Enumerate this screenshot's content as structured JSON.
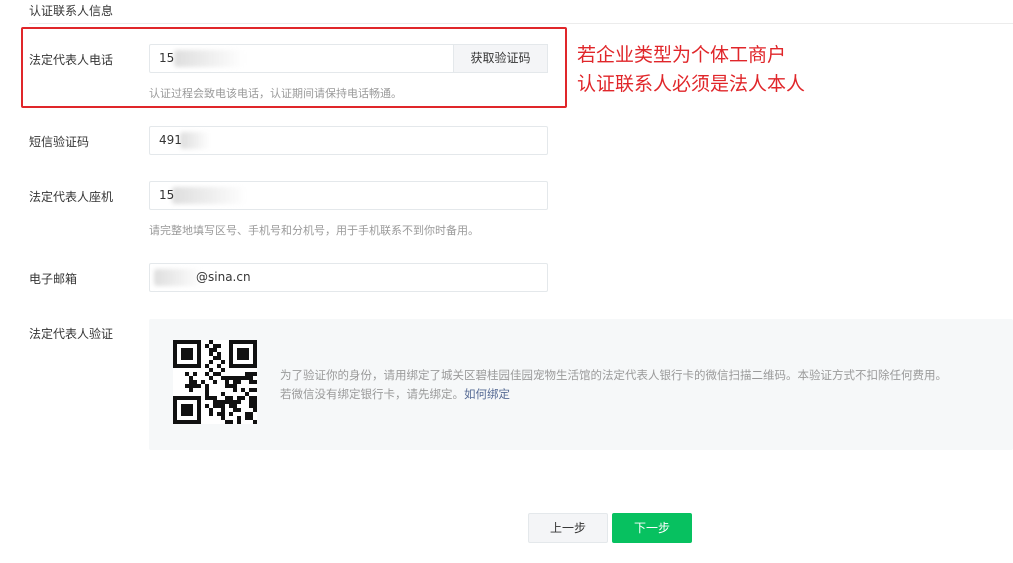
{
  "section": {
    "title": "认证联系人信息"
  },
  "phone": {
    "label": "法定代表人电话",
    "value": "15",
    "get_code_label": "获取验证码",
    "hint": "认证过程会致电该电话，认证期间请保持电话畅通。"
  },
  "annotation": {
    "line1": "若企业类型为个体工商户",
    "line2": "认证联系人必须是法人本人"
  },
  "sms": {
    "label": "短信验证码",
    "value": "491"
  },
  "landline": {
    "label": "法定代表人座机",
    "value": "15",
    "hint": "请完整地填写区号、手机号和分机号，用于手机联系不到你时备用。"
  },
  "email": {
    "label": "电子邮箱",
    "value": "@sina.cn"
  },
  "verify": {
    "label": "法定代表人验证",
    "text_line1": "为了验证你的身份，请用绑定了城关区碧桂园佳园宠物生活馆的法定代表人银行卡的微信扫描二维码。本验证方式不扣除任何费用。",
    "text_line2": "若微信没有绑定银行卡，请先绑定。",
    "link": "如何绑定"
  },
  "buttons": {
    "prev": "上一步",
    "next": "下一步"
  },
  "colors": {
    "accent_green": "#07c160",
    "annotation_red": "#e0262a",
    "link_blue": "#576b95"
  },
  "icons": {
    "qr": "qr-code-icon"
  }
}
